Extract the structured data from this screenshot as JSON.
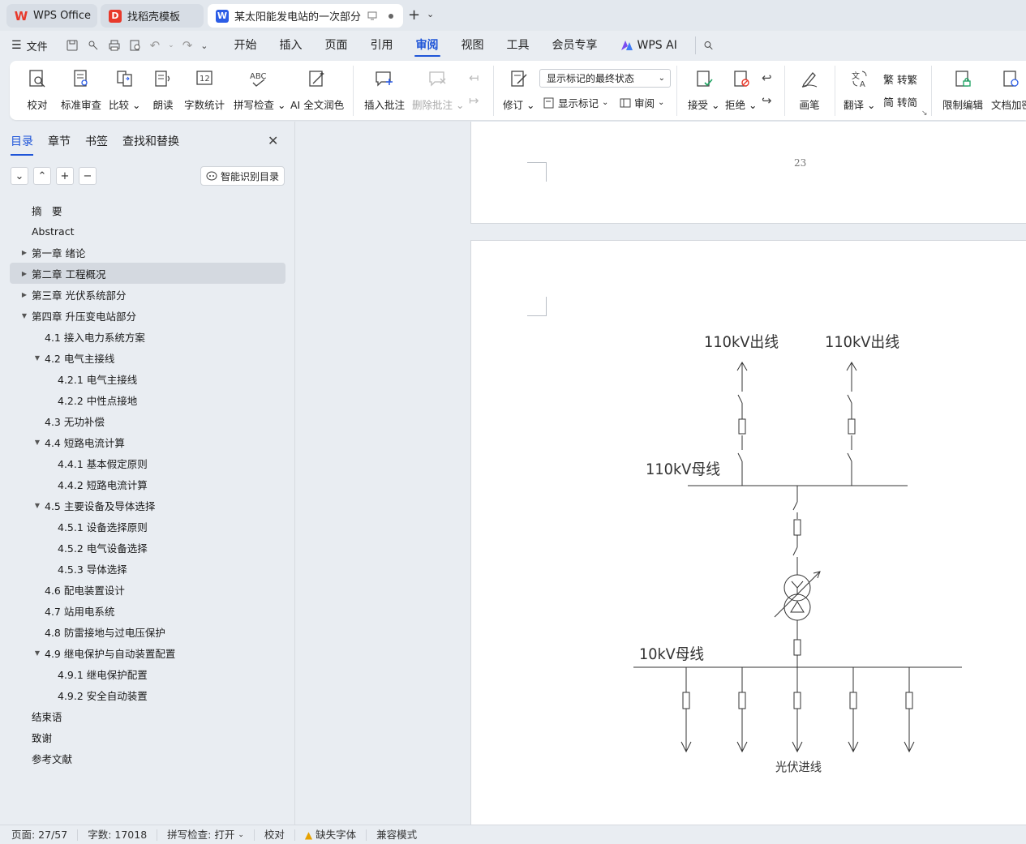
{
  "tabs": [
    {
      "label": "WPS Office"
    },
    {
      "label": "找稻壳模板"
    },
    {
      "label": "某太阳能发电站的一次部分设计"
    }
  ],
  "menu": {
    "file": "文件",
    "items": [
      "开始",
      "插入",
      "页面",
      "引用",
      "审阅",
      "视图",
      "工具",
      "会员专享"
    ],
    "ai": "WPS AI"
  },
  "ribbon": {
    "proof": "校对",
    "std_review": "标准审查",
    "compare": "比较",
    "read_aloud": "朗读",
    "word_count": "字数统计",
    "spell_check": "拼写检查",
    "ai_polish": "AI 全文润色",
    "insert_comment": "插入批注",
    "delete_comment": "删除批注",
    "revise": "修订",
    "markup_state": "显示标记的最终状态",
    "show_markup": "显示标记",
    "review": "审阅",
    "accept": "接受",
    "reject": "拒绝",
    "pen": "画笔",
    "translate": "翻译",
    "to_traditional": "转繁",
    "to_simplified": "转简",
    "restrict_edit": "限制编辑",
    "doc_encrypt": "文档加密"
  },
  "panel": {
    "tabs": [
      "目录",
      "章节",
      "书签",
      "查找和替换"
    ],
    "smart_toc": "智能识别目录",
    "toc": [
      {
        "label": "摘　要",
        "level": 0,
        "arrow": ""
      },
      {
        "label": "Abstract",
        "level": 0,
        "arrow": ""
      },
      {
        "label": "第一章  绪论",
        "level": 0,
        "arrow": "▶"
      },
      {
        "label": "第二章  工程概况",
        "level": 0,
        "arrow": "▶",
        "sel": true
      },
      {
        "label": "第三章  光伏系统部分",
        "level": 0,
        "arrow": "▶"
      },
      {
        "label": "第四章  升压变电站部分",
        "level": 0,
        "arrow": "▼"
      },
      {
        "label": "4.1  接入电力系统方案",
        "level": 1,
        "arrow": ""
      },
      {
        "label": "4.2  电气主接线",
        "level": 1,
        "arrow": "▼"
      },
      {
        "label": "4.2.1  电气主接线",
        "level": 2,
        "arrow": ""
      },
      {
        "label": "4.2.2  中性点接地",
        "level": 2,
        "arrow": ""
      },
      {
        "label": "4.3  无功补偿",
        "level": 1,
        "arrow": ""
      },
      {
        "label": "4.4  短路电流计算",
        "level": 1,
        "arrow": "▼"
      },
      {
        "label": "4.4.1 基本假定原则",
        "level": 2,
        "arrow": ""
      },
      {
        "label": "4.4.2  短路电流计算",
        "level": 2,
        "arrow": ""
      },
      {
        "label": "4.5  主要设备及导体选择",
        "level": 1,
        "arrow": "▼"
      },
      {
        "label": "4.5.1  设备选择原则",
        "level": 2,
        "arrow": ""
      },
      {
        "label": "4.5.2  电气设备选择",
        "level": 2,
        "arrow": ""
      },
      {
        "label": "4.5.3  导体选择",
        "level": 2,
        "arrow": ""
      },
      {
        "label": "4.6  配电装置设计",
        "level": 1,
        "arrow": ""
      },
      {
        "label": "4.7  站用电系统",
        "level": 1,
        "arrow": ""
      },
      {
        "label": "4.8  防雷接地与过电压保护",
        "level": 1,
        "arrow": ""
      },
      {
        "label": "4.9  继电保护与自动装置配置",
        "level": 1,
        "arrow": "▼"
      },
      {
        "label": "4.9.1  继电保护配置",
        "level": 2,
        "arrow": ""
      },
      {
        "label": "4.9.2  安全自动装置",
        "level": 2,
        "arrow": ""
      },
      {
        "label": "结束语",
        "level": 0,
        "arrow": ""
      },
      {
        "label": "致谢",
        "level": 0,
        "arrow": ""
      },
      {
        "label": "参考文献",
        "level": 0,
        "arrow": ""
      }
    ]
  },
  "doc": {
    "page_number": "23",
    "diagram": {
      "out1": "110kV出线",
      "out2": "110kV出线",
      "bus110": "110kV母线",
      "bus10": "10kV母线",
      "pv_in": "光伏进线"
    }
  },
  "status": {
    "page": "页面: 27/57",
    "words": "字数: 17018",
    "spell": "拼写检查: 打开",
    "proof": "校对",
    "missing_font": "缺失字体",
    "compat": "兼容模式"
  },
  "colors": {
    "accent": "#1f55d8",
    "wps_red": "#e8392b",
    "doc_blue": "#2b5ce6"
  }
}
